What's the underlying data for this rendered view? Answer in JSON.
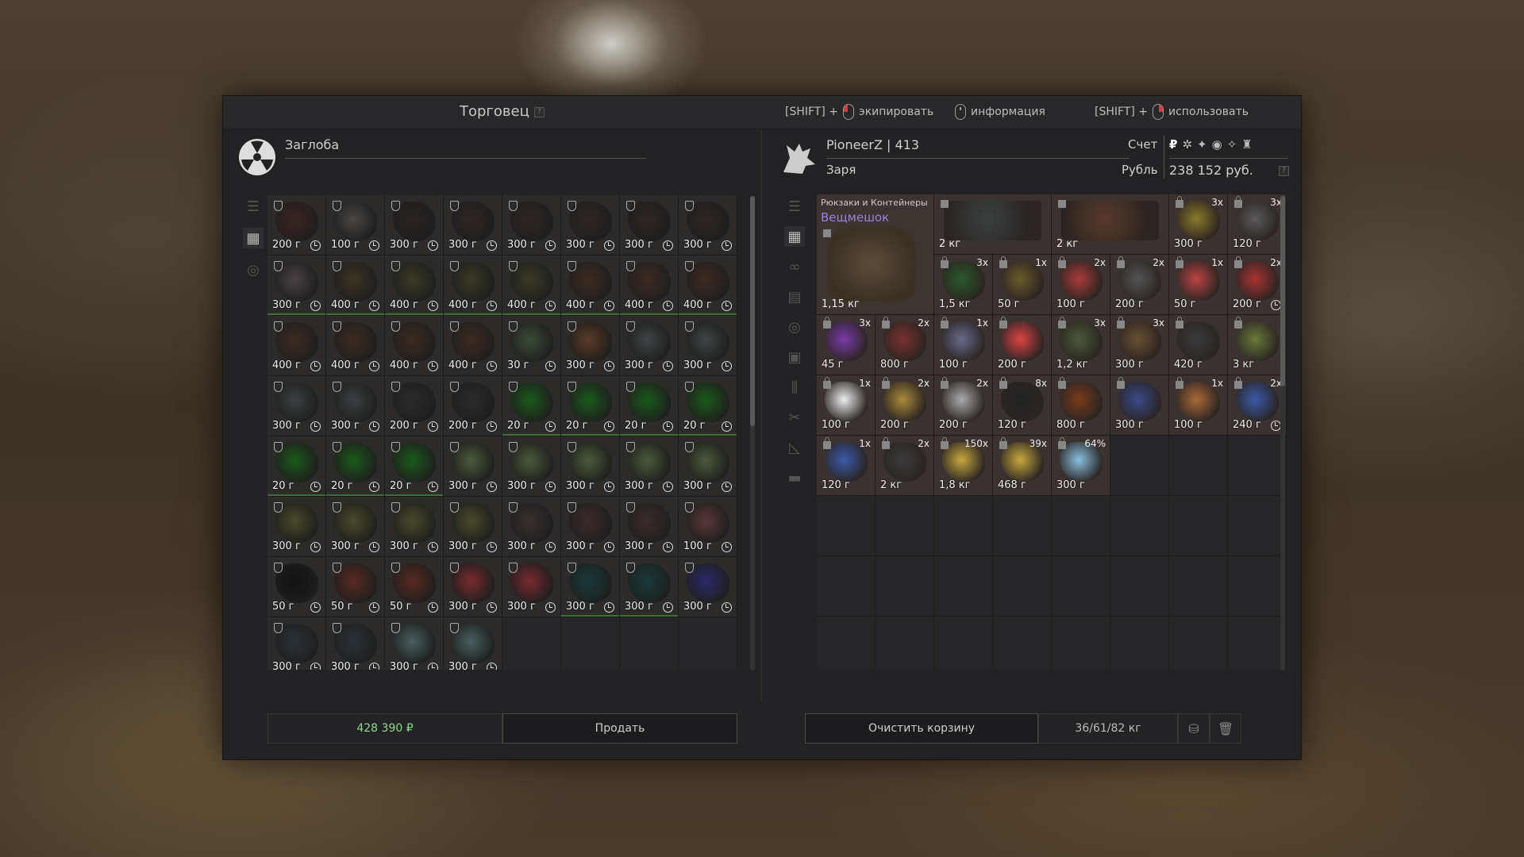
{
  "window": {
    "title": "Торговец",
    "help": "?"
  },
  "hints": [
    {
      "prefix": "[SHIFT] +",
      "label": "экипировать"
    },
    {
      "prefix": "",
      "label": "информация"
    },
    {
      "prefix": "[SHIFT] +",
      "label": "использовать"
    }
  ],
  "trader": {
    "name": "Заглоба",
    "total": "428 390 ₽",
    "sell_label": "Продать"
  },
  "trader_items": [
    "200 г",
    "100 г",
    "300 г",
    "300 г",
    "300 г",
    "300 г",
    "300 г",
    "300 г",
    "300 г",
    "400 г",
    "400 г",
    "400 г",
    "400 г",
    "400 г",
    "400 г",
    "400 г",
    "400 г",
    "400 г",
    "400 г",
    "400 г",
    "30 г",
    "300 г",
    "300 г",
    "300 г",
    "300 г",
    "300 г",
    "200 г",
    "200 г",
    "20 г",
    "20 г",
    "20 г",
    "20 г",
    "20 г",
    "20 г",
    "20 г",
    "300 г",
    "300 г",
    "300 г",
    "300 г",
    "300 г",
    "300 г",
    "300 г",
    "300 г",
    "300 г",
    "300 г",
    "300 г",
    "300 г",
    "100 г",
    "50 г",
    "50 г",
    "50 г",
    "300 г",
    "300 г",
    "300 г",
    "300 г",
    "300 г",
    "300 г",
    "300 г",
    "300 г",
    "300 г"
  ],
  "player": {
    "name": "PioneerZ | 413",
    "faction": "Заря",
    "account_label": "Счет",
    "currency_label": "Рубль",
    "balance": "238 152 руб.",
    "currency_icons": [
      "₽",
      "✲",
      "✦",
      "◉",
      "✧",
      "♜"
    ],
    "clear_label": "Очистить корзину",
    "weight": "36/61/82 кг"
  },
  "backpack": {
    "category": "Рюкзаки и Контейнеры",
    "name": "Вещмешок",
    "price": "1,15 кг"
  },
  "player_items": [
    {
      "price": "2 кг",
      "qty": ""
    },
    {
      "price": "2 кг",
      "qty": ""
    },
    {
      "price": "300 г",
      "qty": "3x"
    },
    {
      "price": "120 г",
      "qty": "3x"
    },
    {
      "price": "1,5 кг",
      "qty": "3x"
    },
    {
      "price": "50 г",
      "qty": "1x"
    },
    {
      "price": "100 г",
      "qty": "2x"
    },
    {
      "price": "200 г",
      "qty": "2x"
    },
    {
      "price": "50 г",
      "qty": "1x"
    },
    {
      "price": "200 г",
      "qty": "2x"
    },
    {
      "price": "45 г",
      "qty": "3x"
    },
    {
      "price": "800 г",
      "qty": "2x"
    },
    {
      "price": "100 г",
      "qty": "1x"
    },
    {
      "price": "200 г",
      "qty": ""
    },
    {
      "price": "1,2 кг",
      "qty": "3x"
    },
    {
      "price": "300 г",
      "qty": "3x"
    },
    {
      "price": "420 г",
      "qty": ""
    },
    {
      "price": "3 кг",
      "qty": ""
    },
    {
      "price": "100 г",
      "qty": "1x"
    },
    {
      "price": "200 г",
      "qty": "2x"
    },
    {
      "price": "200 г",
      "qty": "2x"
    },
    {
      "price": "120 г",
      "qty": "8x"
    },
    {
      "price": "800 г",
      "qty": ""
    },
    {
      "price": "300 г",
      "qty": ""
    },
    {
      "price": "100 г",
      "qty": "1x"
    },
    {
      "price": "240 г",
      "qty": "2x"
    },
    {
      "price": "120 г",
      "qty": "1x"
    },
    {
      "price": "2 кг",
      "qty": "2x"
    },
    {
      "price": "1,8 кг",
      "qty": "150x"
    },
    {
      "price": "468 г",
      "qty": "39x"
    },
    {
      "price": "300 г",
      "qty": "64%"
    }
  ]
}
